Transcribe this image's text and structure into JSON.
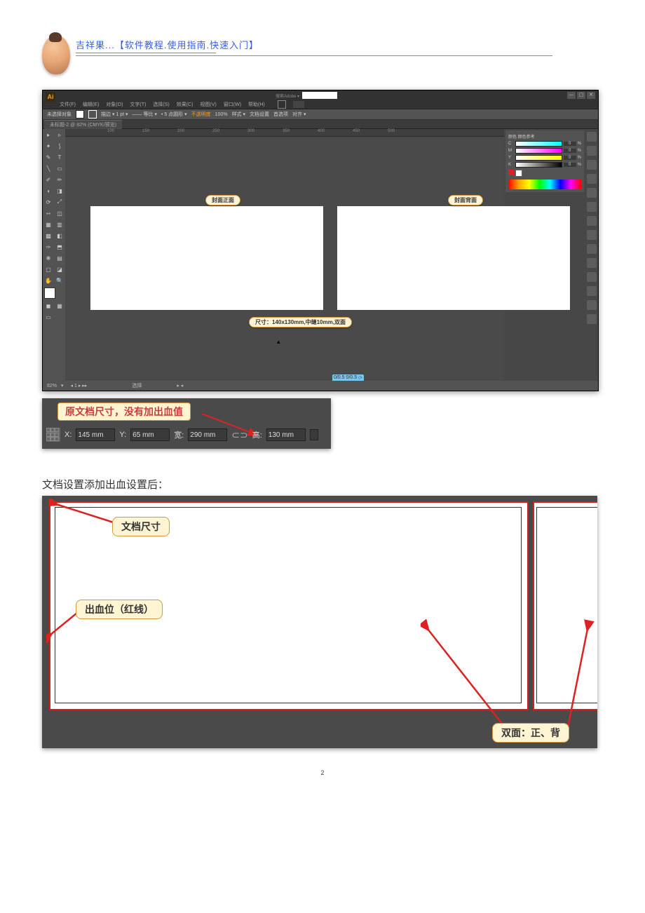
{
  "header": {
    "title": "吉祥果...【软件教程.使用指南.快速入门】"
  },
  "ai": {
    "brand": "Ai",
    "search_placeholder": "搜索Adobe ▾",
    "menus": [
      "文件(F)",
      "编辑(E)",
      "对象(O)",
      "文字(T)",
      "选择(S)",
      "效果(C)",
      "视图(V)",
      "窗口(W)",
      "帮助(H)"
    ],
    "ctrl": {
      "nosel": "未选择对象",
      "units": "描边 ▾ 1 pt ▾",
      "uniform": "—— 等比 ▾",
      "basic": "• 5 点圆形 ▾",
      "opacity_lbl": "不透明度",
      "opacity_val": "100%",
      "style": "样式 ▾",
      "docset": "文档设置",
      "prefs": "首选项",
      "align": "对齐 ▾"
    },
    "tab": "未标题-2 @ 82% (CMYK/预览)",
    "ruler": [
      "100",
      "150",
      "200",
      "250",
      "300",
      "350",
      "400",
      "450",
      "500"
    ],
    "labels": {
      "front": "封面正面",
      "back": "封面背面",
      "size": "尺寸：140x130mm,中缝10mm,双面"
    },
    "panel": {
      "title": "颜色  颜色参考",
      "c": "C",
      "m": "M",
      "y": "Y",
      "k": "K",
      "val": "0",
      "pct": "%"
    },
    "status": {
      "zoom": "82%",
      "sel": "选择",
      "chips": [
        "0/0.5",
        "0/0.5"
      ]
    }
  },
  "shot2": {
    "callout": "原文档尺寸，没有加出血值",
    "x_lbl": "X:",
    "x": "145 mm",
    "y_lbl": "Y:",
    "y": "65 mm",
    "w_lbl": "宽:",
    "w": "290 mm",
    "h_lbl": "高:",
    "h": "130 mm"
  },
  "body_text": "文档设置添加出血设置后：",
  "shot3": {
    "c1": "文档尺寸",
    "c2": "出血位（红线）",
    "c3": "双面：正、背"
  },
  "page": "2"
}
